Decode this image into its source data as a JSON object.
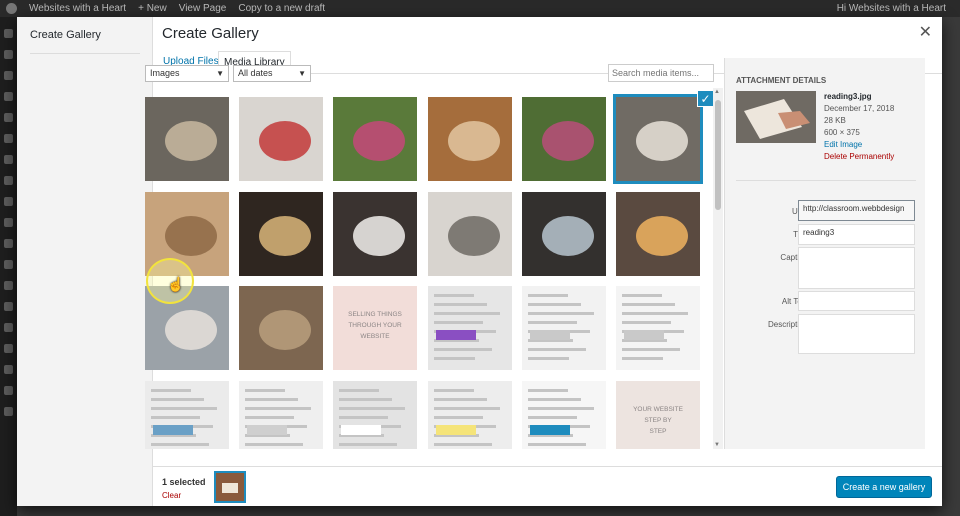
{
  "adminbar": {
    "site": "Websites with a Heart",
    "new": "+ New",
    "view": "View Page",
    "copy": "Copy to a new draft",
    "howdy": "Hi Websites with a Heart"
  },
  "menu": {
    "item": "Create Gallery"
  },
  "modal": {
    "title": "Create Gallery",
    "close_icon": "✕"
  },
  "tabs": [
    {
      "label": "Upload Files"
    },
    {
      "label": "Media Library"
    }
  ],
  "toolbar": {
    "type_filter": "Images",
    "date_filter": "All dates",
    "search_placeholder": "Search media items..."
  },
  "grid": {
    "selected_index": 5,
    "thumbs": [
      {
        "name": "cat-on-sill",
        "bg": "#6b665e",
        "accent": "#c8b9a0",
        "text": ""
      },
      {
        "name": "cat-with-yarn",
        "bg": "#d9d5d0",
        "accent": "#c23a3a",
        "text": ""
      },
      {
        "name": "kittens-in-basket-1",
        "bg": "#5a7a3a",
        "accent": "#c5487a",
        "text": ""
      },
      {
        "name": "hand-kitten",
        "bg": "#a56d3c",
        "accent": "#e2c6a0",
        "text": ""
      },
      {
        "name": "kittens-in-basket-2",
        "bg": "#4f6d34",
        "accent": "#b94e7a",
        "text": ""
      },
      {
        "name": "reading3",
        "bg": "#706b64",
        "accent": "#e8e2d8",
        "text": ""
      },
      {
        "name": "woman-reading-bed",
        "bg": "#c7a37c",
        "accent": "#8e6a47",
        "text": ""
      },
      {
        "name": "reading-window",
        "bg": "#2f2620",
        "accent": "#d9b67a",
        "text": ""
      },
      {
        "name": "writing-notes",
        "bg": "#3a3330",
        "accent": "#f2f0ec",
        "text": ""
      },
      {
        "name": "writing-journal",
        "bg": "#d8d4cf",
        "accent": "#6f6a64",
        "text": ""
      },
      {
        "name": "laptop-window",
        "bg": "#33302e",
        "accent": "#b8c6cf",
        "text": ""
      },
      {
        "name": "light-jar",
        "bg": "#5a4a40",
        "accent": "#f0b360",
        "text": ""
      },
      {
        "name": "reading-sofa",
        "bg": "#9ba2a8",
        "accent": "#e6e1da",
        "text": ""
      },
      {
        "name": "bookshelf",
        "bg": "#7d6650",
        "accent": "#b99f7d",
        "text": ""
      },
      {
        "name": "selling-things",
        "bg": "#f2ddd9",
        "accent": "#e8c9c2",
        "text": "SELLING THINGS THROUGH YOUR WEBSITE"
      },
      {
        "name": "screenshot-menu",
        "bg": "#e6e6e6",
        "accent": "#8a4fc2",
        "text": ""
      },
      {
        "name": "screenshot-form",
        "bg": "#f2f2f2",
        "accent": "#c9c9c9",
        "text": ""
      },
      {
        "name": "screenshot-settings",
        "bg": "#f4f4f4",
        "accent": "#c9c9c9",
        "text": ""
      },
      {
        "name": "screenshot-table",
        "bg": "#ebebeb",
        "accent": "#6aa0c6",
        "text": ""
      },
      {
        "name": "screenshot-list",
        "bg": "#efefef",
        "accent": "#cfcfcf",
        "text": ""
      },
      {
        "name": "screenshot-dialog",
        "bg": "#e3e3e3",
        "accent": "#ffffff",
        "text": ""
      },
      {
        "name": "screenshot-dropdown",
        "bg": "#ededed",
        "accent": "#f5e479",
        "text": ""
      },
      {
        "name": "screenshot-page",
        "bg": "#f6f6f6",
        "accent": "#1e8cbe",
        "text": ""
      },
      {
        "name": "website-step-by-step",
        "bg": "#ede4e0",
        "accent": "#d9c7c0",
        "text": "YOUR WEBSITE STEP BY STEP"
      }
    ]
  },
  "details": {
    "heading": "Attachment Details",
    "filename": "reading3.jpg",
    "date": "December 17, 2018",
    "size": "28 KB",
    "dimensions": "600 × 375",
    "edit_link": "Edit Image",
    "delete_link": "Delete Permanently",
    "url_label": "URL",
    "url_value": "http://classroom.webbdesign",
    "title_label": "Title",
    "title_value": "reading3",
    "caption_label": "Caption",
    "alt_label": "Alt Text",
    "description_label": "Description"
  },
  "footer": {
    "selected_count": "1 selected",
    "clear": "Clear",
    "primary_button": "Create a new gallery"
  }
}
